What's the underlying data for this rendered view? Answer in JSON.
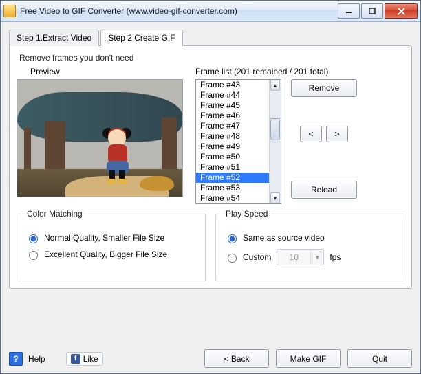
{
  "window": {
    "title": "Free Video to GIF Converter (www.video-gif-converter.com)"
  },
  "tabs": {
    "step1": "Step 1.Extract Video",
    "step2": "Step 2.Create GIF"
  },
  "removeFrames": {
    "heading": "Remove frames you don't need",
    "previewLabel": "Preview",
    "frameListTitle": "Frame list (201 remained / 201 total)",
    "frames": [
      "Frame #43",
      "Frame #44",
      "Frame #45",
      "Frame #46",
      "Frame #47",
      "Frame #48",
      "Frame #49",
      "Frame #50",
      "Frame #51",
      "Frame #52",
      "Frame #53",
      "Frame #54"
    ],
    "selectedIndex": 9,
    "removeBtn": "Remove",
    "prevBtn": "<",
    "nextBtn": ">",
    "reloadBtn": "Reload"
  },
  "colorMatching": {
    "legend": "Color Matching",
    "normal": "Normal Quality, Smaller File Size",
    "excellent": "Excellent Quality, Bigger File Size",
    "selected": "normal"
  },
  "playSpeed": {
    "legend": "Play Speed",
    "same": "Same as source video",
    "custom": "Custom",
    "fpsValue": "10",
    "fpsUnit": "fps",
    "selected": "same"
  },
  "bottom": {
    "help": "Help",
    "like": "Like",
    "back": "< Back",
    "make": "Make GIF",
    "quit": "Quit"
  }
}
